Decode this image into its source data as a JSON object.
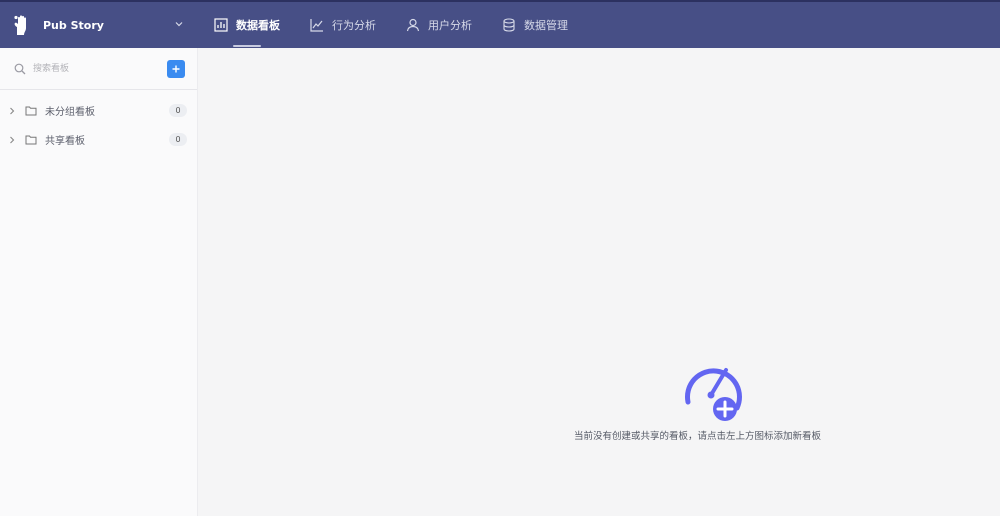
{
  "header": {
    "project_name": "Pub Story",
    "logo_icon": "hand-logo-icon",
    "nav": [
      {
        "label": "数据看板",
        "icon": "bar-chart-icon",
        "active": true
      },
      {
        "label": "行为分析",
        "icon": "trend-chart-icon",
        "active": false
      },
      {
        "label": "用户分析",
        "icon": "user-icon",
        "active": false
      },
      {
        "label": "数据管理",
        "icon": "database-icon",
        "active": false
      }
    ]
  },
  "sidebar": {
    "search_placeholder": "搜索看板",
    "add_button_icon": "plus-icon",
    "groups": [
      {
        "label": "未分组看板",
        "count": "0"
      },
      {
        "label": "共享看板",
        "count": "0"
      }
    ]
  },
  "main": {
    "empty_icon": "dashboard-add-icon",
    "empty_message": "当前没有创建或共享的看板，请点击左上方图标添加新看板"
  },
  "colors": {
    "header_bg": "#474f86",
    "accent": "#3a8bf0",
    "empty_icon": "#6366f1"
  }
}
